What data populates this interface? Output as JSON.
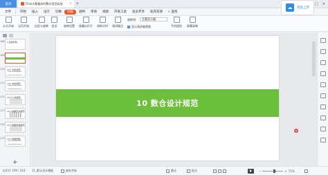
{
  "titlebar": {
    "home_tab": "首页",
    "doc_title": "Flink大数据实时数仓项目实战",
    "close": "×",
    "new_tab": "+"
  },
  "menu": {
    "file": "文件",
    "items": [
      "开始",
      "插入",
      "设计",
      "切换",
      "动画",
      "放映",
      "审阅",
      "视图",
      "开发工具",
      "会员专享",
      "稻壳资源"
    ],
    "active_index": 4,
    "search": "查找"
  },
  "cloud_button": {
    "label": "现高上字"
  },
  "ribbon": {
    "buttons": [
      "从头开始",
      "当页开始",
      "自定义放映",
      "会议",
      "放映设置",
      "隐藏幻灯片",
      "排练计时",
      "演讲备注",
      "手机遥控",
      "屏幕录制"
    ],
    "monitor_label": "放映到:",
    "monitor_value": "主要显示器",
    "show_notes": "显示演讲者视图"
  },
  "thumbnails": [
    {
      "num": "168",
      "kind": "title",
      "text": "9 实施代码"
    },
    {
      "num": "169",
      "kind": "band",
      "text": "10 数仓设计规范",
      "selected": true
    },
    {
      "num": "170",
      "kind": "lines",
      "text": "10.1 命名规范"
    },
    {
      "num": "171",
      "kind": "lines",
      "text": "10.1 命名规范"
    },
    {
      "num": "172",
      "kind": "table",
      "text": "10.2 公共规范"
    },
    {
      "num": "173",
      "kind": "table",
      "text": "10.3 数据同步规范"
    },
    {
      "num": "174",
      "kind": "table",
      "text": "10.4 数据存储规范"
    },
    {
      "num": "175",
      "kind": "lines",
      "text": "10.5 数据质量"
    }
  ],
  "slide": {
    "title": "10  数仓设计规范",
    "band_color": "#6cbf3a"
  },
  "slide_note": "单击此处添加备注",
  "statusbar": {
    "page": "幻灯片 169 / 314",
    "theme": "11_默认设计模板",
    "font_missing": "缺失字体",
    "notes": "备注",
    "comments": "批注",
    "zoom": "71%"
  },
  "colors": {
    "accent": "#e8572a",
    "home": "#4a90e2",
    "cloud": "#2e8de6"
  }
}
